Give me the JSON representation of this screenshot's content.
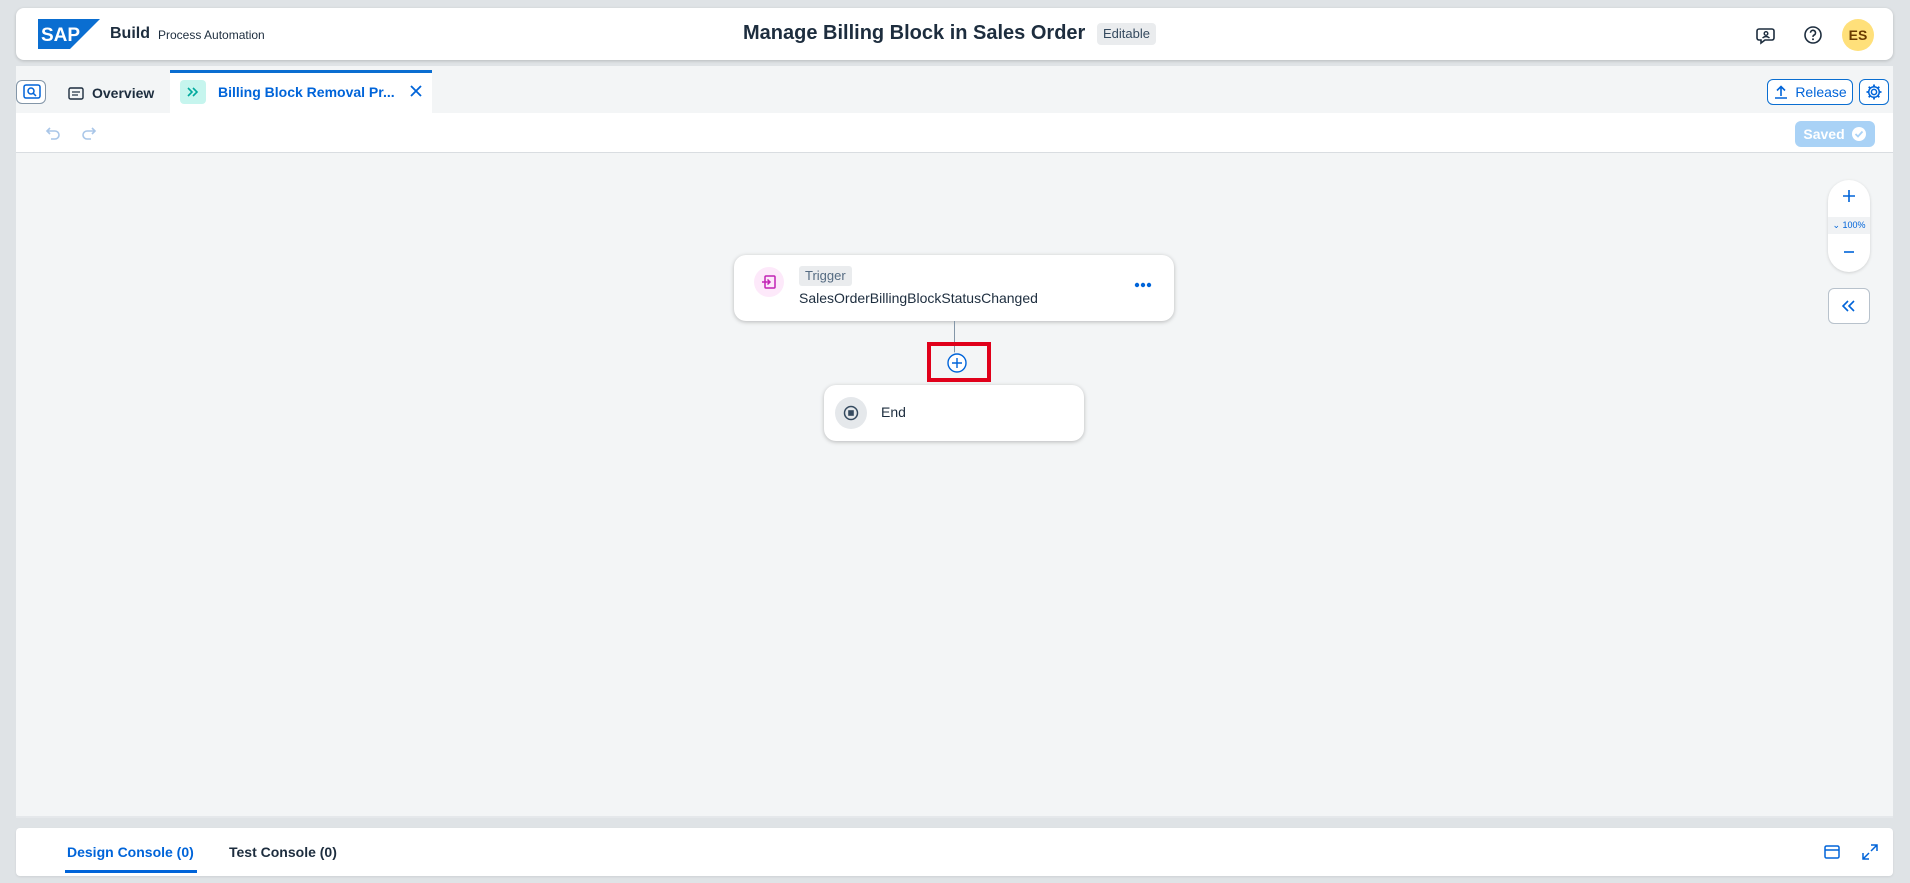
{
  "shell": {
    "brand": "Build",
    "product": "Process Automation",
    "title": "Manage Billing Block in Sales Order",
    "status_badge": "Editable",
    "avatar_initials": "ES",
    "icons": [
      "feedback-icon",
      "help-icon"
    ]
  },
  "tabs": {
    "overview_label": "Overview",
    "active_label": "Billing Block Removal Pr...",
    "release_label": "Release"
  },
  "toolbar": {
    "saved_label": "Saved"
  },
  "canvas": {
    "zoom_level": "100%",
    "trigger": {
      "tag": "Trigger",
      "name": "SalesOrderBillingBlockStatusChanged"
    },
    "end": {
      "label": "End"
    }
  },
  "console": {
    "design_tab": "Design Console (0)",
    "test_tab": "Test Console (0)"
  },
  "colors": {
    "accent": "#0064d9",
    "highlight": "#e0001a",
    "trigger_icon": "#c223b5",
    "tab_icon": "#00a99d"
  }
}
